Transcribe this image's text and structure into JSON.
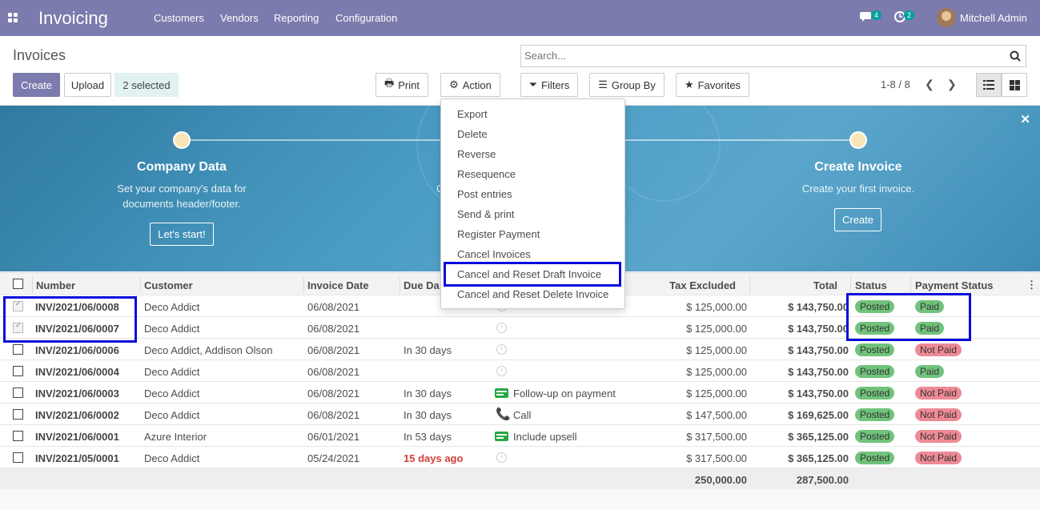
{
  "app": {
    "title": "Invoicing",
    "menus": [
      "Customers",
      "Vendors",
      "Reporting",
      "Configuration"
    ]
  },
  "systray": {
    "messages_count": "4",
    "activities_count": "2",
    "user": "Mitchell Admin"
  },
  "control_panel": {
    "title": "Invoices",
    "create": "Create",
    "upload": "Upload",
    "selected": "2 selected",
    "print": "Print",
    "action": "Action",
    "search_placeholder": "Search...",
    "filters": "Filters",
    "group_by": "Group By",
    "favorites": "Favorites",
    "pager": "1-8 / 8"
  },
  "banner": {
    "steps": [
      {
        "title": "Company Data",
        "desc1": "Set your company's data for",
        "desc2": "documents header/footer.",
        "button": "Let's start!"
      },
      {
        "title": "Create Invoice",
        "desc1": "Create your first invoice.",
        "button": "Create"
      }
    ],
    "hidden_fragment": "C"
  },
  "action_menu": [
    "Export",
    "Delete",
    "Reverse",
    "Resequence",
    "Post entries",
    "Send & print",
    "Register Payment",
    "Cancel Invoices",
    "Cancel and Reset Draft Invoice",
    "Cancel and Reset Delete Invoice"
  ],
  "table": {
    "headers": {
      "number": "Number",
      "customer": "Customer",
      "invoice_date": "Invoice Date",
      "due_date": "Due Da",
      "tax_excluded": "Tax Excluded",
      "total": "Total",
      "status": "Status",
      "payment_status": "Payment Status"
    },
    "rows": [
      {
        "checked": true,
        "number": "INV/2021/06/0008",
        "customer": "Deco Addict",
        "invoice_date": "06/08/2021",
        "due": "",
        "due_late": false,
        "activity": "",
        "activity_type": "clock",
        "tax_excluded": "$ 125,000.00",
        "total": "$ 143,750.00",
        "status": "Posted",
        "payment_status": "Paid"
      },
      {
        "checked": true,
        "number": "INV/2021/06/0007",
        "customer": "Deco Addict",
        "invoice_date": "06/08/2021",
        "due": "",
        "due_late": false,
        "activity": "",
        "activity_type": "clock",
        "tax_excluded": "$ 125,000.00",
        "total": "$ 143,750.00",
        "status": "Posted",
        "payment_status": "Paid"
      },
      {
        "checked": false,
        "number": "INV/2021/06/0006",
        "customer": "Deco Addict, Addison Olson",
        "invoice_date": "06/08/2021",
        "due": "In 30 days",
        "due_late": false,
        "activity": "",
        "activity_type": "clock",
        "tax_excluded": "$ 125,000.00",
        "total": "$ 143,750.00",
        "status": "Posted",
        "payment_status": "Not Paid"
      },
      {
        "checked": false,
        "number": "INV/2021/06/0004",
        "customer": "Deco Addict",
        "invoice_date": "06/08/2021",
        "due": "",
        "due_late": false,
        "activity": "",
        "activity_type": "clock",
        "tax_excluded": "$ 125,000.00",
        "total": "$ 143,750.00",
        "status": "Posted",
        "payment_status": "Paid"
      },
      {
        "checked": false,
        "number": "INV/2021/06/0003",
        "customer": "Deco Addict",
        "invoice_date": "06/08/2021",
        "due": "In 30 days",
        "due_late": false,
        "activity": "Follow-up on payment",
        "activity_type": "todo",
        "tax_excluded": "$ 125,000.00",
        "total": "$ 143,750.00",
        "status": "Posted",
        "payment_status": "Not Paid"
      },
      {
        "checked": false,
        "number": "INV/2021/06/0002",
        "customer": "Deco Addict",
        "invoice_date": "06/08/2021",
        "due": "In 30 days",
        "due_late": false,
        "activity": "Call",
        "activity_type": "phone",
        "tax_excluded": "$ 147,500.00",
        "total": "$ 169,625.00",
        "status": "Posted",
        "payment_status": "Not Paid"
      },
      {
        "checked": false,
        "number": "INV/2021/06/0001",
        "customer": "Azure Interior",
        "invoice_date": "06/01/2021",
        "due": "In 53 days",
        "due_late": false,
        "activity": "Include upsell",
        "activity_type": "todo",
        "tax_excluded": "$ 317,500.00",
        "total": "$ 365,125.00",
        "status": "Posted",
        "payment_status": "Not Paid"
      },
      {
        "checked": false,
        "number": "INV/2021/05/0001",
        "customer": "Deco Addict",
        "invoice_date": "05/24/2021",
        "due": "15 days ago",
        "due_late": true,
        "activity": "",
        "activity_type": "clock",
        "tax_excluded": "$ 317,500.00",
        "total": "$ 365,125.00",
        "status": "Posted",
        "payment_status": "Not Paid"
      }
    ],
    "totals": {
      "tax_excluded": "250,000.00",
      "total": "287,500.00"
    }
  },
  "colors": {
    "brand": "#7c7bad",
    "paid": "#71c37b",
    "not_paid": "#ee8a96",
    "highlight": "#0a0adc"
  }
}
